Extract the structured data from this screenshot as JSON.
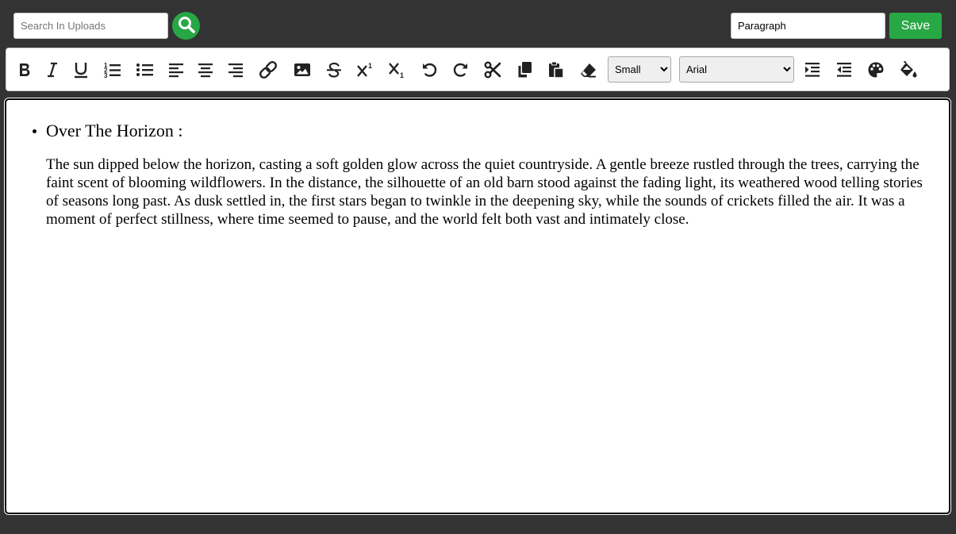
{
  "search": {
    "placeholder": "Search In Uploads",
    "button_icon": "search-icon",
    "button_color": "#28a745"
  },
  "header": {
    "title_value": "Paragraph",
    "save_label": "Save",
    "save_color": "#28a745"
  },
  "toolbar": {
    "buttons": [
      {
        "name": "bold",
        "icon": "bold-icon"
      },
      {
        "name": "italic",
        "icon": "italic-icon"
      },
      {
        "name": "underline",
        "icon": "underline-icon"
      },
      {
        "name": "ordered-list",
        "icon": "ordered-list-icon"
      },
      {
        "name": "unordered-list",
        "icon": "unordered-list-icon"
      },
      {
        "name": "align-left",
        "icon": "align-left-icon"
      },
      {
        "name": "align-center",
        "icon": "align-center-icon"
      },
      {
        "name": "align-right",
        "icon": "align-right-icon"
      },
      {
        "name": "link",
        "icon": "link-icon"
      },
      {
        "name": "image",
        "icon": "image-icon"
      },
      {
        "name": "strikethrough",
        "icon": "strikethrough-icon"
      },
      {
        "name": "superscript",
        "icon": "superscript-icon"
      },
      {
        "name": "subscript",
        "icon": "subscript-icon"
      },
      {
        "name": "undo",
        "icon": "undo-icon"
      },
      {
        "name": "redo",
        "icon": "redo-icon"
      },
      {
        "name": "cut",
        "icon": "scissors-icon"
      },
      {
        "name": "copy",
        "icon": "copy-icon"
      },
      {
        "name": "paste",
        "icon": "paste-icon"
      },
      {
        "name": "clear-format",
        "icon": "eraser-icon"
      },
      {
        "name": "indent",
        "icon": "indent-icon"
      },
      {
        "name": "outdent",
        "icon": "outdent-icon"
      },
      {
        "name": "text-color",
        "icon": "palette-icon"
      },
      {
        "name": "highlight",
        "icon": "fill-bucket-icon"
      }
    ],
    "font_size_selected": "Small",
    "font_family_selected": "Arial"
  },
  "editor": {
    "heading": "Over The Horizon :",
    "paragraph": "The sun dipped below the horizon, casting a soft golden glow across the quiet countryside. A gentle breeze rustled through the trees, carrying the faint scent of blooming wildflowers. In the distance, the silhouette of an old barn stood against the fading light, its weathered wood telling stories of seasons long past. As dusk settled in, the first stars began to twinkle in the deepening sky, while the sounds of crickets filled the air. It was a moment of perfect stillness, where time seemed to pause, and the world felt both vast and intimately close."
  },
  "colors": {
    "background": "#333333",
    "accent": "#28a745",
    "icon": "#222222"
  }
}
